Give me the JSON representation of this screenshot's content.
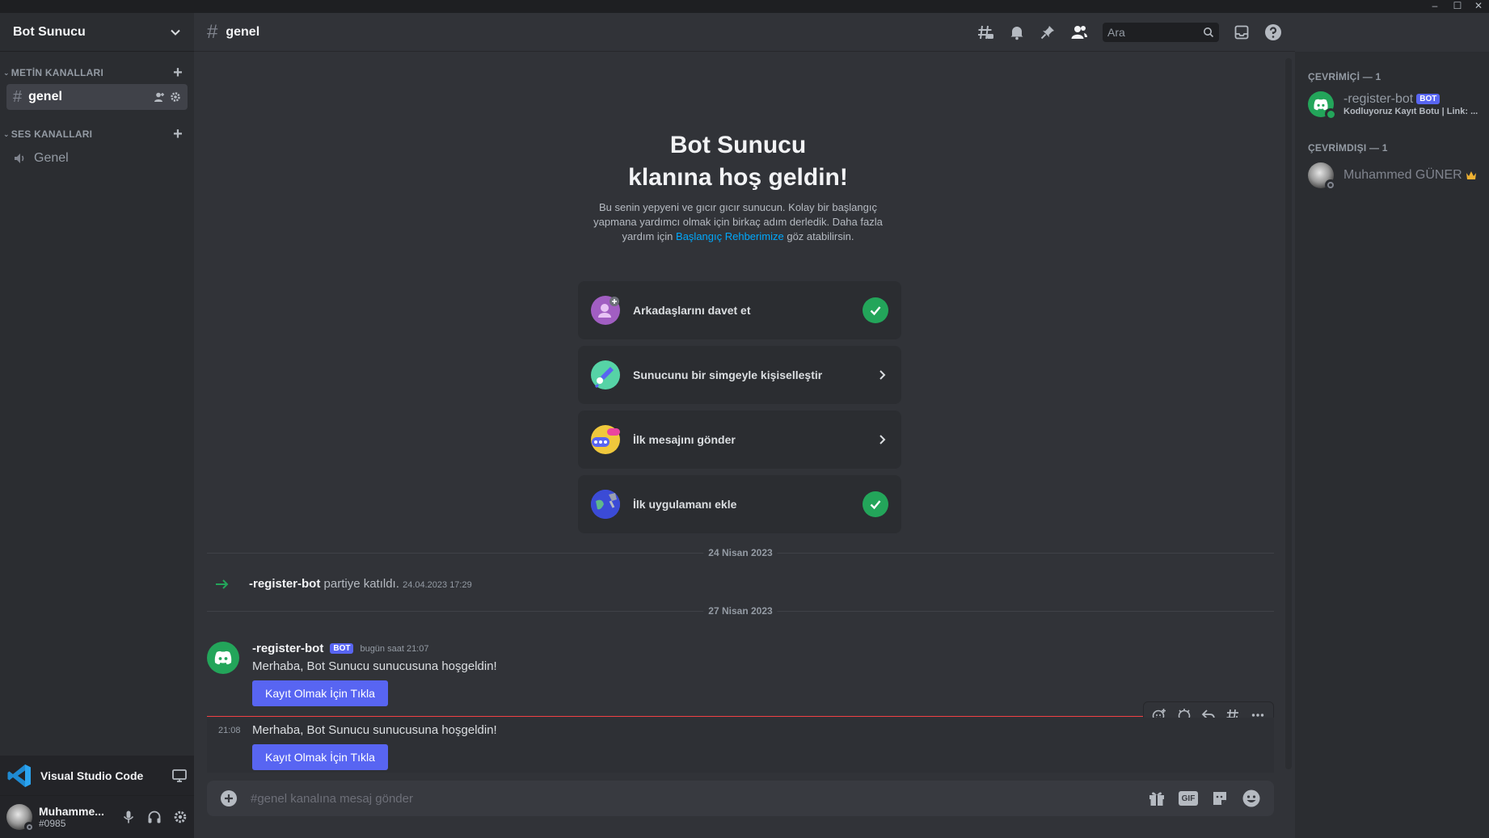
{
  "window": {
    "minimize": "–",
    "maximize": "☐",
    "close": "✕"
  },
  "sidebar": {
    "server_name": "Bot Sunucu",
    "text_category": "METİN KANALLARI",
    "text_channel": "genel",
    "voice_category": "SES KANALLARI",
    "voice_channel": "Genel",
    "activity_app": "Visual Studio Code",
    "user_name": "Muhamme...",
    "user_tag": "#0985"
  },
  "header": {
    "channel": "genel",
    "search_placeholder": "Ara"
  },
  "welcome": {
    "line1": "Bot Sunucu",
    "line2": "klanına hoş geldin!",
    "desc1": "Bu senin yepyeni ve gıcır gıcır sunucun. Kolay bir başlangıç",
    "desc2": "yapmana yardımcı olmak için birkaç adım derledik. Daha fazla",
    "desc3_pre": "yardım için",
    "desc3_link": "Başlangıç Rehberimize",
    "desc3_post": "göz atabilirsin.",
    "tasks": [
      {
        "label": "Arkadaşlarını davet et",
        "done": true
      },
      {
        "label": "Sunucunu bir simgeyle kişiselleştir",
        "done": false
      },
      {
        "label": "İlk mesajını gönder",
        "done": false
      },
      {
        "label": "İlk uygulamanı ekle",
        "done": true
      }
    ]
  },
  "messages": {
    "date1": "24 Nisan 2023",
    "join_user": "-register-bot",
    "join_text": "partiye katıldı.",
    "join_time": "24.04.2023 17:29",
    "date2": "27 Nisan 2023",
    "bot_name": "-register-bot",
    "bot_tag": "BOT",
    "bot_time": "bugün saat 21:07",
    "msg1_text": "Merhaba, Bot Sunucu sunucusuna hoşgeldin!",
    "msg1_button": "Kayıt Olmak İçin Tıkla",
    "msg2_time": "21:08",
    "msg2_text": "Merhaba, Bot Sunucu sunucusuna hoşgeldin!",
    "msg2_button": "Kayıt Olmak İçin Tıkla"
  },
  "composer": {
    "placeholder": "#genel kanalına mesaj gönder",
    "gif": "GIF"
  },
  "members": {
    "online_header": "ÇEVRİMİÇİ — 1",
    "online_name": "-register-bot",
    "online_tag": "BOT",
    "online_status": "Kodluyoruz Kayıt Botu | Link: ...",
    "offline_header": "ÇEVRİMDIŞI — 1",
    "offline_name": "Muhammed GÜNER"
  },
  "colors": {
    "accent": "#5865f2",
    "online": "#23a55a",
    "link": "#00a8fc",
    "new_divider": "#f23f43"
  }
}
